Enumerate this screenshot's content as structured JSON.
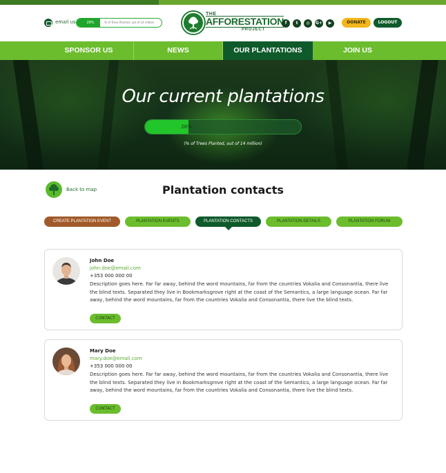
{
  "header": {
    "email_label": "email us",
    "mini_progress": {
      "percent_label": "28%",
      "caption": "% of Trees Planted, out of 14 million",
      "value": 0.28
    },
    "logo": {
      "the": "THE",
      "main": "AFFORESTATION",
      "project": "PROJECT"
    },
    "social": [
      {
        "icon": "facebook-icon",
        "glyph": "f"
      },
      {
        "icon": "twitter-icon",
        "glyph": "t"
      },
      {
        "icon": "instagram-icon",
        "glyph": "◎"
      },
      {
        "icon": "google-plus-icon",
        "glyph": "G+"
      },
      {
        "icon": "youtube-icon",
        "glyph": "▶"
      }
    ],
    "donate_label": "DONATE",
    "logout_label": "LOGOUT"
  },
  "nav": {
    "items": [
      {
        "label": "SPONSOR US"
      },
      {
        "label": "NEWS"
      },
      {
        "label": "OUR PLANTATIONS",
        "active": true
      },
      {
        "label": "JOIN US"
      }
    ]
  },
  "hero": {
    "title": "Our current plantations",
    "progress": {
      "percent_label": "28%",
      "value": 0.28
    },
    "caption": "(% of Trees Planted, out of 14 million)"
  },
  "section": {
    "back_label": "Back to map",
    "title": "Plantation contacts",
    "tabs": [
      {
        "label": "CREATE PLANTATION EVENT"
      },
      {
        "label": "PLANTATION EVENTS"
      },
      {
        "label": "PLANTATION CONTACTS",
        "active": true
      },
      {
        "label": "PLANTATION DETAILS"
      },
      {
        "label": "PLANTATION FORUM"
      }
    ]
  },
  "contacts": [
    {
      "name": "John Doe",
      "email": "john.doe@email.com",
      "phone": "+353 000 000 00",
      "description": "Description goes here. Far far away, behind the word mountains, far from the countries Vokalia and Consonantia, there live the blind texts. Separated they live in Bookmarksgrove right at the coast of the Semantics, a large language ocean. Far far away, behind the word mountains, far from the countries Vokalia and Consonantia, there live the blind texts.",
      "button_label": "CONTACT"
    },
    {
      "name": "Mary Doe",
      "email": "mary.doe@email.com",
      "phone": "+353 000 000 00",
      "description": "Description goes here. Far far away, behind the word mountains, far from the countries Vokalia and Consonantia, there live the blind texts. Separated they live in Bookmarksgrove right at the coast of the Semantics, a large language ocean. Far far away, behind the word mountains, far from the countries Vokalia and Consonantia, there live the blind texts.",
      "button_label": "CONTACT"
    }
  ],
  "colors": {
    "primary_green": "#6cbd2e",
    "dark_green": "#0f5a2b",
    "donate_yellow": "#f1b71c",
    "create_brown": "#a15a2a"
  }
}
